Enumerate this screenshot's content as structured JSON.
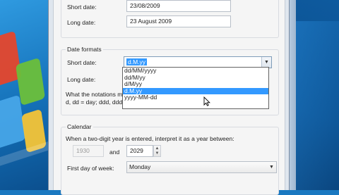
{
  "number_format": {
    "short_date_label": "Short date:",
    "short_date_value": "23/08/2009",
    "long_date_label": "Long date:",
    "long_date_value": "23 August 2009"
  },
  "date_formats": {
    "title": "Date formats",
    "short_date_label": "Short date:",
    "short_date_selected": "d.M.yy",
    "long_date_label": "Long date:",
    "notation_text_1": "What the notations m",
    "notation_text_2": "d, dd = day;  ddd, ddd",
    "options": [
      "dd/MM/yyyy",
      "dd/M/yy",
      "d/M/yy",
      "d.M.yy",
      "yyyy-MM-dd"
    ],
    "highlighted_index": 3
  },
  "calendar": {
    "title": "Calendar",
    "interpret_text": "When a two-digit year is entered, interpret it as a year between:",
    "year_from": "1930",
    "and_label": "and",
    "year_to": "2029",
    "first_day_label": "First day of week:",
    "first_day_value": "Monday"
  },
  "icons": {
    "dropdown_arrow": "chevron-down-icon",
    "spin_up": "spin-up-icon",
    "spin_down": "spin-down-icon",
    "cursor": "mouse-pointer-icon"
  },
  "colors": {
    "selection": "#3399ff",
    "desktop_blue": "#1a78c0"
  }
}
